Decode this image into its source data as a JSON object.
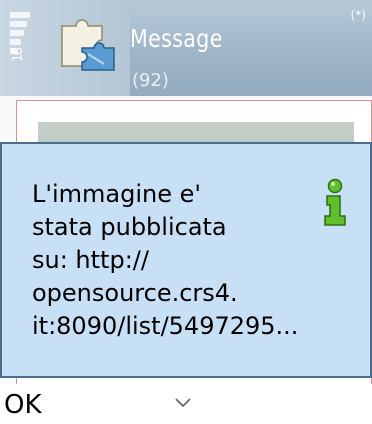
{
  "status": {
    "signal_label": "1G",
    "bluetooth_indicator": "(*)"
  },
  "header": {
    "app_icon": "puzzle-icon",
    "title": "Message",
    "count": "(92)"
  },
  "dialog": {
    "icon": "info-icon",
    "text": "L'immagine e'\nstata pubblicata\nsu: http://\nopensource.crs4.\nit:8090/list/5497295..."
  },
  "softkeys": {
    "left_label": "OK",
    "center_icon": "chevron-down-icon"
  },
  "colors": {
    "header_bg": "#a7bccd",
    "dialog_bg": "#c8e0f6",
    "dialog_border": "#4a6c8d",
    "frame_border": "#e68e8e",
    "info_icon": "#3f9a1c"
  }
}
